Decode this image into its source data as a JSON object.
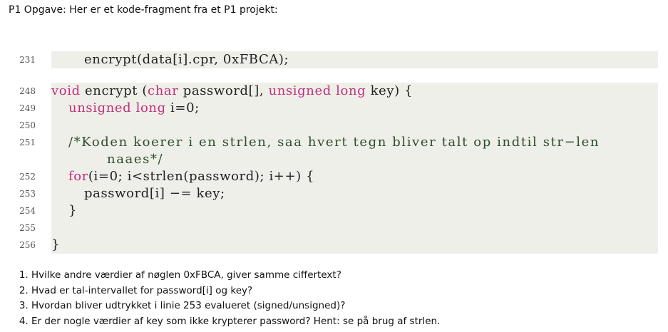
{
  "heading": "P1 Opgave: Her er et kode-fragment fra et P1 projekt:",
  "code": {
    "line231": {
      "num": "231",
      "t1": "encrypt(data[i].cpr, 0xFBCA);"
    },
    "line248": {
      "num": "248",
      "kw1": "void",
      "t1": " encrypt (",
      "kw2": "char",
      "t2": " password[], ",
      "kw3": "unsigned long",
      "t3": " key) {"
    },
    "line249": {
      "num": "249",
      "kw1": "unsigned long",
      "t1": " i=0;"
    },
    "line250": {
      "num": "250"
    },
    "line251": {
      "num": "251",
      "c1": "/*Koden koerer i en strlen, saa hvert tegn bliver talt op indtil str−len"
    },
    "line251b": {
      "c1": "naaes*/"
    },
    "line252": {
      "num": "252",
      "kw1": "for",
      "t1": "(i=0; i<strlen(password); i++) {"
    },
    "line253": {
      "num": "253",
      "t1": "password[i] −= key;"
    },
    "line254": {
      "num": "254",
      "t1": "}"
    },
    "line255": {
      "num": "255"
    },
    "line256": {
      "num": "256",
      "t1": "}"
    }
  },
  "questions": [
    "Hvilke andre  værdier af nøglen 0xFBCA, giver samme ciffertext?",
    "Hvad er tal-intervallet for password[i] og key?",
    "Hvordan bliver udtrykket i linie 253 evalueret (signed/unsigned)?",
    "Er der nogle værdier af key som ikke krypterer password? Hent: se på brug af strlen."
  ]
}
